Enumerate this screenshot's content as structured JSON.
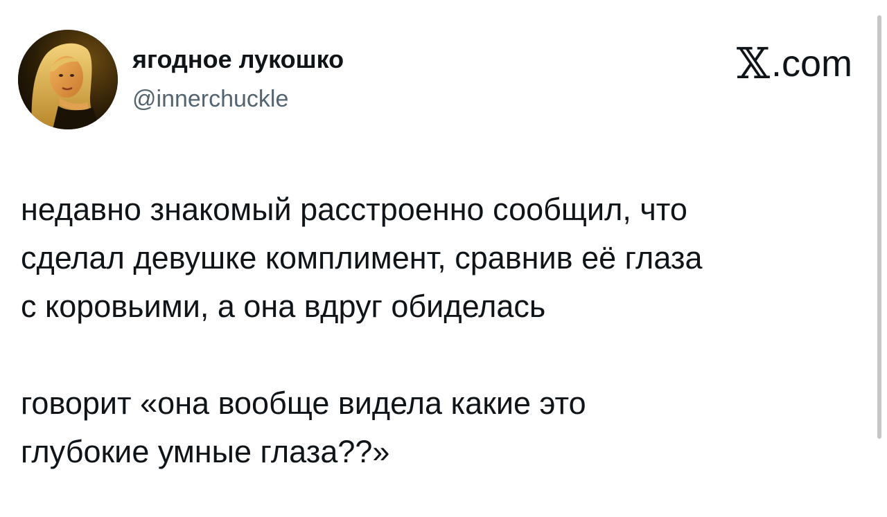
{
  "author": {
    "display_name": "ягодное лукошко",
    "handle": "@innerchuckle",
    "avatar_icon": "profile-photo"
  },
  "brand": {
    "x_glyph": "𝕏",
    "domain": ".com"
  },
  "tweet": {
    "paragraph_1": "недавно знакомый расстроенно сообщил, что\nсделал девушке комплимент, сравнив её глаза\nс коровьими, а она вдруг обиделась",
    "paragraph_2": "говорит «она вообще видела какие это\nглубокие умные глаза??»"
  },
  "colors": {
    "text_primary": "#0f1419",
    "text_secondary": "#536471",
    "background": "#ffffff"
  }
}
